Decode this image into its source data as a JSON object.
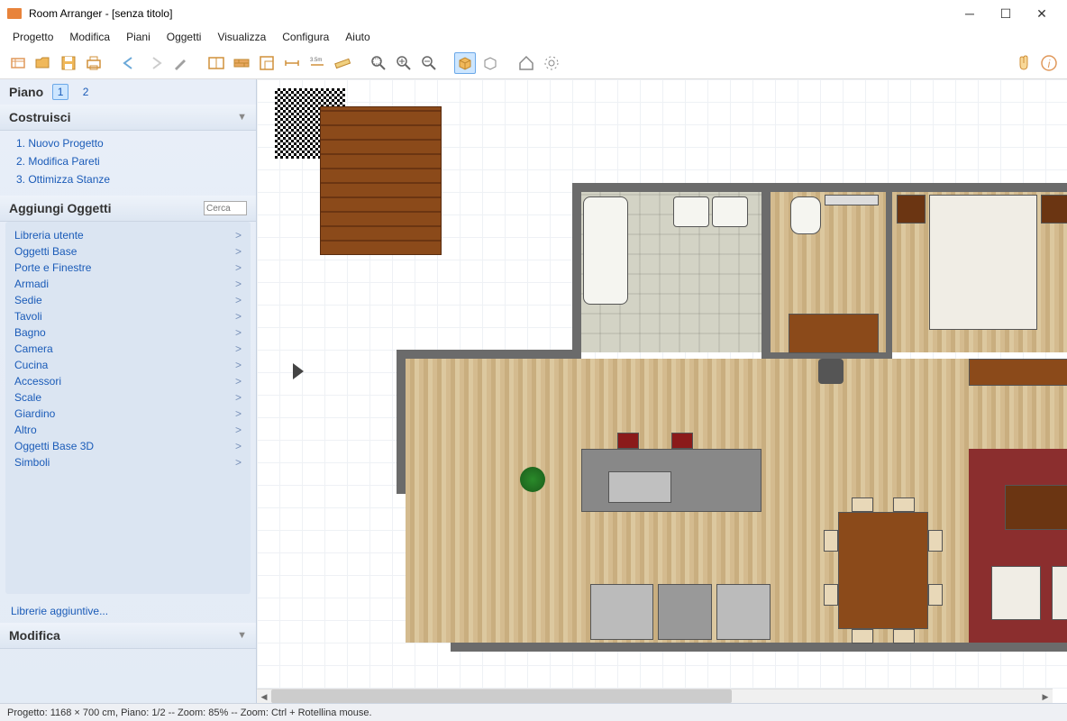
{
  "title": "Room Arranger - [senza titolo]",
  "menu": [
    "Progetto",
    "Modifica",
    "Piani",
    "Oggetti",
    "Visualizza",
    "Configura",
    "Aiuto"
  ],
  "sidebar": {
    "floor_label": "Piano",
    "floors": [
      "1",
      "2"
    ],
    "active_floor": 0,
    "build_header": "Costruisci",
    "build_items": [
      "1. Nuovo Progetto",
      "2. Modifica Pareti",
      "3. Ottimizza Stanze"
    ],
    "add_header": "Aggiungi Oggetti",
    "search_placeholder": "Cerca",
    "categories": [
      "Libreria utente",
      "Oggetti Base",
      "Porte e Finestre",
      "Armadi",
      "Sedie",
      "Tavoli",
      "Bagno",
      "Camera",
      "Cucina",
      "Accessori",
      "Scale",
      "Giardino",
      "Altro",
      "Oggetti Base 3D",
      "Simboli"
    ],
    "extra_lib": "Librerie aggiuntive...",
    "modify_header": "Modifica"
  },
  "status": "Progetto: 1168 × 700 cm, Piano: 1/2 -- Zoom: 85% -- Zoom: Ctrl + Rotellina mouse."
}
